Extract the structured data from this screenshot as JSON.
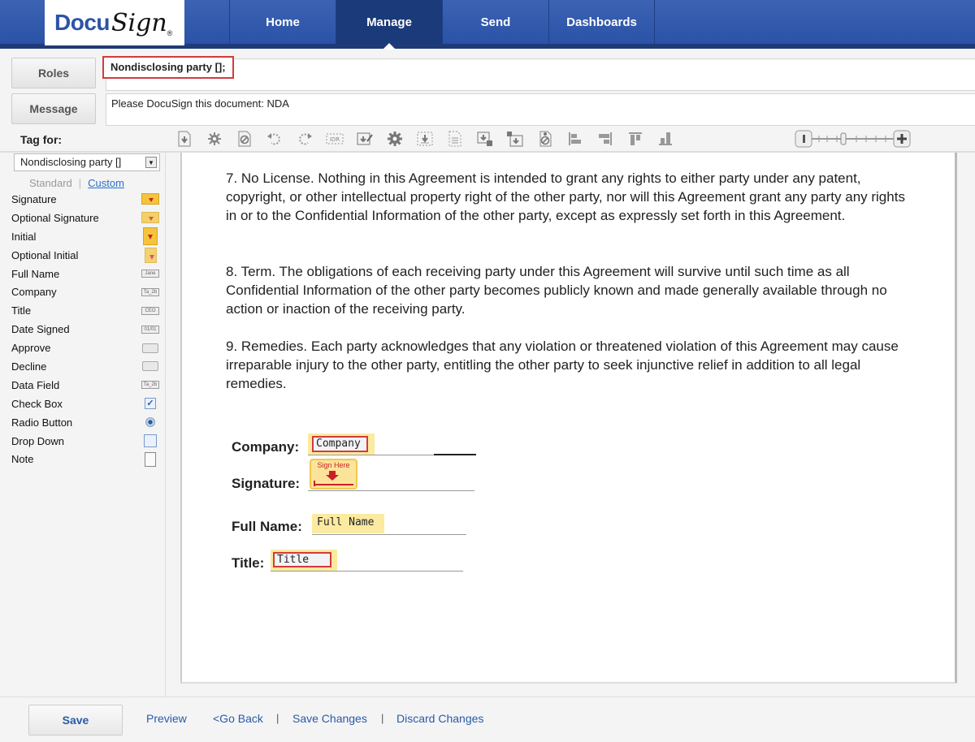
{
  "brand": {
    "logo_docu": "Docu",
    "logo_sign": "Sign",
    "logo_reg": "®"
  },
  "nav": {
    "items": [
      {
        "label": "Home",
        "active": false
      },
      {
        "label": "Manage",
        "active": true
      },
      {
        "label": "Send",
        "active": false
      },
      {
        "label": "Dashboards",
        "active": false
      }
    ]
  },
  "header": {
    "roles_button": "Roles",
    "roles_value": "Nondisclosing party [];",
    "message_button": "Message",
    "message_value": "Please DocuSign this document: NDA",
    "tag_for_label": "Tag for:"
  },
  "toolbar": {
    "icons": [
      "download-icon",
      "settings-burst-icon",
      "block-icon",
      "undo-icon",
      "redo-icon",
      "id-tag-icon",
      "edit-sign-icon",
      "gear-icon",
      "dashed-download-icon",
      "dashed-document-icon",
      "copy-down-icon",
      "move-icon",
      "block-copy-icon",
      "align-left-icon",
      "align-right-icon",
      "align-top-icon",
      "align-bottom-icon"
    ],
    "zoom_level": 0.4
  },
  "sidebar": {
    "party_select": "Nondisclosing party []",
    "tab_standard": "Standard",
    "tab_separator": "|",
    "tab_custom": "Custom",
    "tags": [
      {
        "label": "Signature",
        "icon": "signature-tag-icon"
      },
      {
        "label": "Optional Signature",
        "icon": "optional-signature-tag-icon"
      },
      {
        "label": "Initial",
        "icon": "initial-tag-icon"
      },
      {
        "label": "Optional Initial",
        "icon": "optional-initial-tag-icon"
      },
      {
        "label": "Full Name",
        "icon": "full-name-tag-icon",
        "icon_text": "Jane"
      },
      {
        "label": "Company",
        "icon": "company-tag-icon",
        "icon_text": "Ta_2b"
      },
      {
        "label": "Title",
        "icon": "title-tag-icon",
        "icon_text": "CEO"
      },
      {
        "label": "Date Signed",
        "icon": "date-signed-tag-icon",
        "icon_text": "01/01"
      },
      {
        "label": "Approve",
        "icon": "approve-tag-icon"
      },
      {
        "label": "Decline",
        "icon": "decline-tag-icon"
      },
      {
        "label": "Data Field",
        "icon": "data-field-tag-icon",
        "icon_text": "Ta_2b"
      },
      {
        "label": "Check Box",
        "icon": "checkbox-tag-icon"
      },
      {
        "label": "Radio Button",
        "icon": "radio-tag-icon"
      },
      {
        "label": "Drop Down",
        "icon": "dropdown-tag-icon"
      },
      {
        "label": "Note",
        "icon": "note-tag-icon"
      }
    ]
  },
  "document": {
    "paragraphs": [
      "7. No License. Nothing in this Agreement is intended to grant any rights to either party under any patent, copyright, or other intellectual property right of the other party, nor will this Agreement grant any party any rights in or to the Confidential Information of the other party, except as expressly set forth in this Agreement.",
      "8. Term. The obligations of each receiving party under this Agreement will survive until such time as all Confidential Information of the other party becomes publicly known and made generally available through no action or inaction of the receiving party.",
      "9. Remedies. Each party acknowledges that any violation or threatened violation of this Agreement may cause irreparable injury to the other party, entitling the other party to seek injunctive relief in addition to all legal remedies."
    ],
    "form": {
      "company_label": "Company:",
      "company_field": "Company",
      "signature_label": "Signature:",
      "sign_here": "Sign Here",
      "fullname_label": "Full Name:",
      "fullname_field": "Full Name",
      "title_label": "Title:",
      "title_field": "Title"
    }
  },
  "footer": {
    "save": "Save",
    "preview": "Preview",
    "go_back": "<Go Back",
    "sep": "|",
    "save_changes": "Save Changes",
    "discard_changes": "Discard Changes"
  },
  "colors": {
    "nav_bg": "#2a52a6",
    "nav_active": "#1a3a7a",
    "highlight_red": "#d23b3b",
    "link_blue": "#2a5aa8",
    "field_yellow": "#fbeaa0"
  }
}
